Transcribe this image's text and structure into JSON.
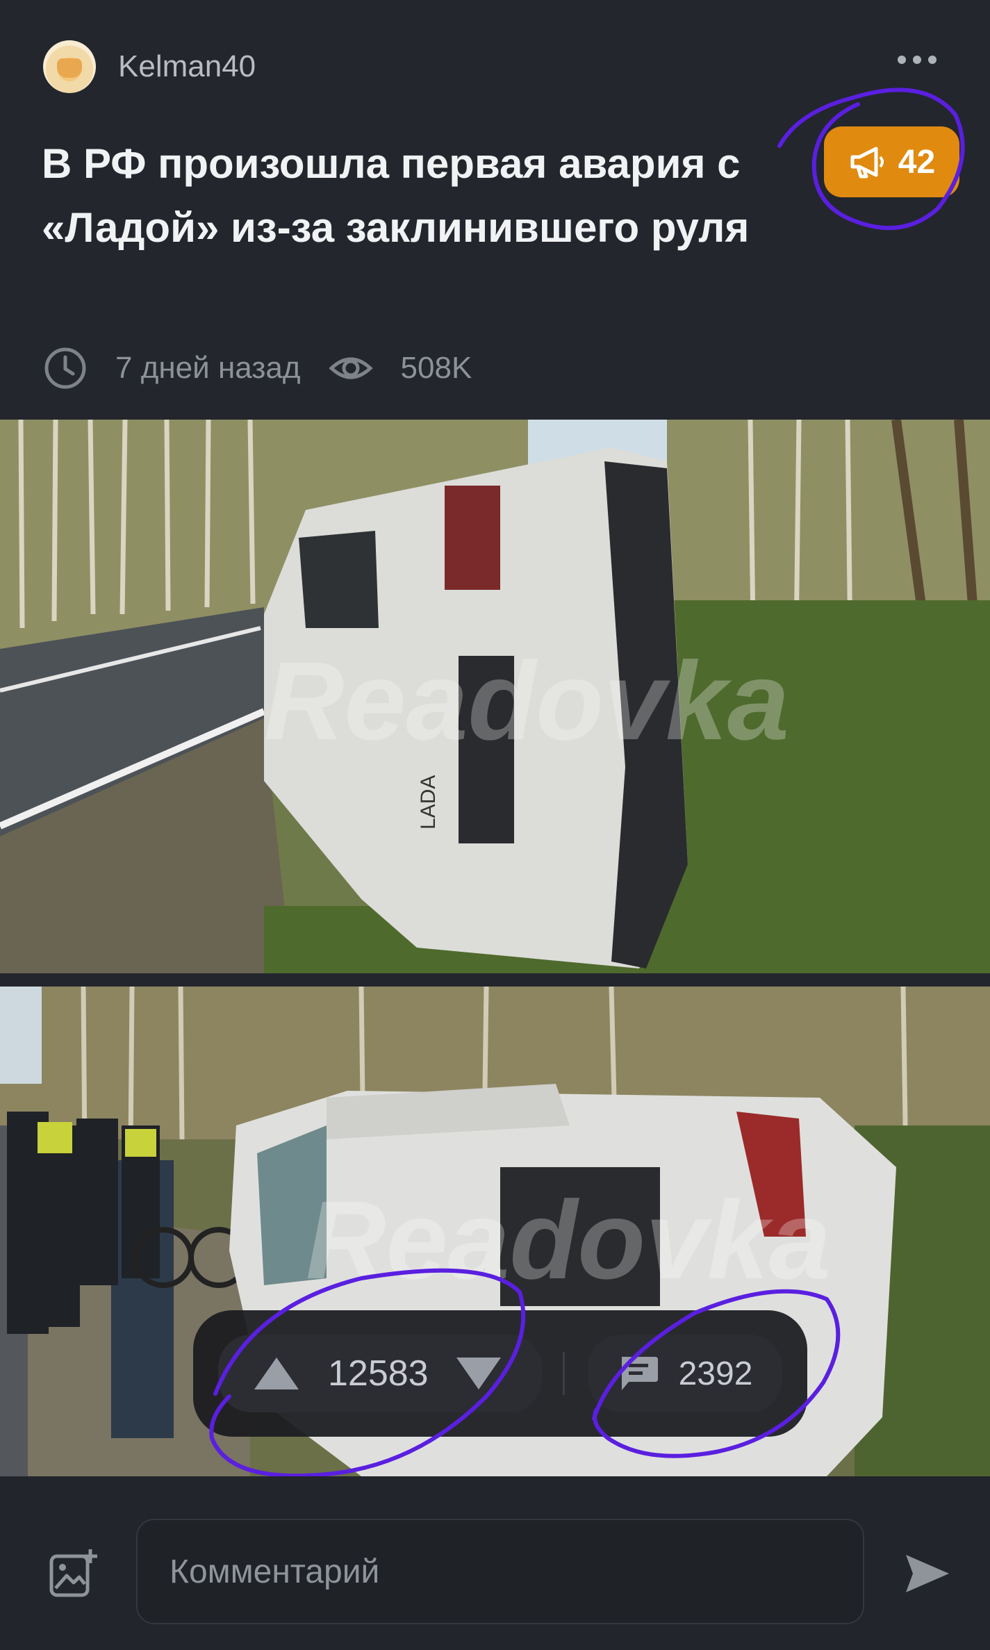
{
  "post": {
    "author": "Kelman40",
    "title": "В РФ произошла первая авария с «Ладой» из-за заклинившего руля",
    "badge_count": "42",
    "time_ago": "7 дней назад",
    "views": "508K"
  },
  "photos": [
    {
      "icons": [
        "photo-overturned-car-1"
      ]
    },
    {
      "icons": [
        "photo-overturned-car-2"
      ]
    }
  ],
  "actions": {
    "votes": "12583",
    "comments": "2392"
  },
  "composer": {
    "placeholder": "Комментарий"
  },
  "colors": {
    "background": "#22252b",
    "badge": "#e08a10",
    "annotation": "#5a1fe0"
  }
}
